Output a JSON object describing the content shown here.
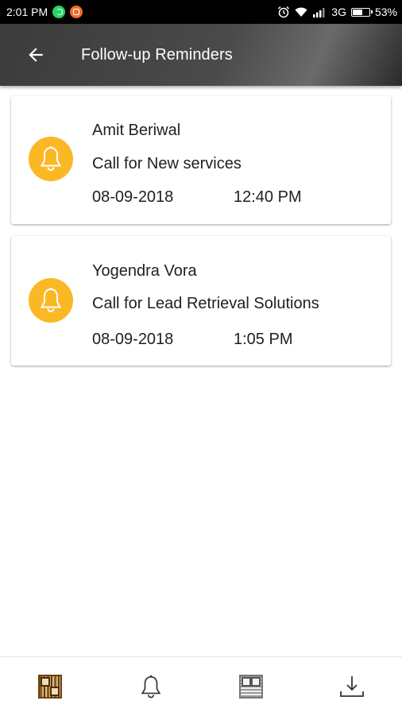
{
  "status_bar": {
    "time": "2:01 PM",
    "network": "3G",
    "battery": "53%",
    "battery_level": 0.53
  },
  "app_bar": {
    "title": "Follow-up Reminders",
    "back_icon": "arrow-left-icon"
  },
  "reminders": [
    {
      "name": "Amit Beriwal",
      "description": "Call for New services",
      "date": "08-09-2018",
      "time": "12:40 PM",
      "icon": "bell-icon"
    },
    {
      "name": "Yogendra Vora",
      "description": "Call for Lead Retrieval Solutions",
      "date": "08-09-2018",
      "time": "1:05 PM",
      "icon": "bell-icon"
    }
  ],
  "bottom_nav": {
    "items": [
      {
        "icon": "qr-code-color-icon"
      },
      {
        "icon": "bell-outline-icon"
      },
      {
        "icon": "qr-code-icon"
      },
      {
        "icon": "download-icon"
      }
    ]
  },
  "colors": {
    "accent": "#FBB825",
    "app_bar": "#4a4a4a",
    "status_bar": "#000000"
  }
}
